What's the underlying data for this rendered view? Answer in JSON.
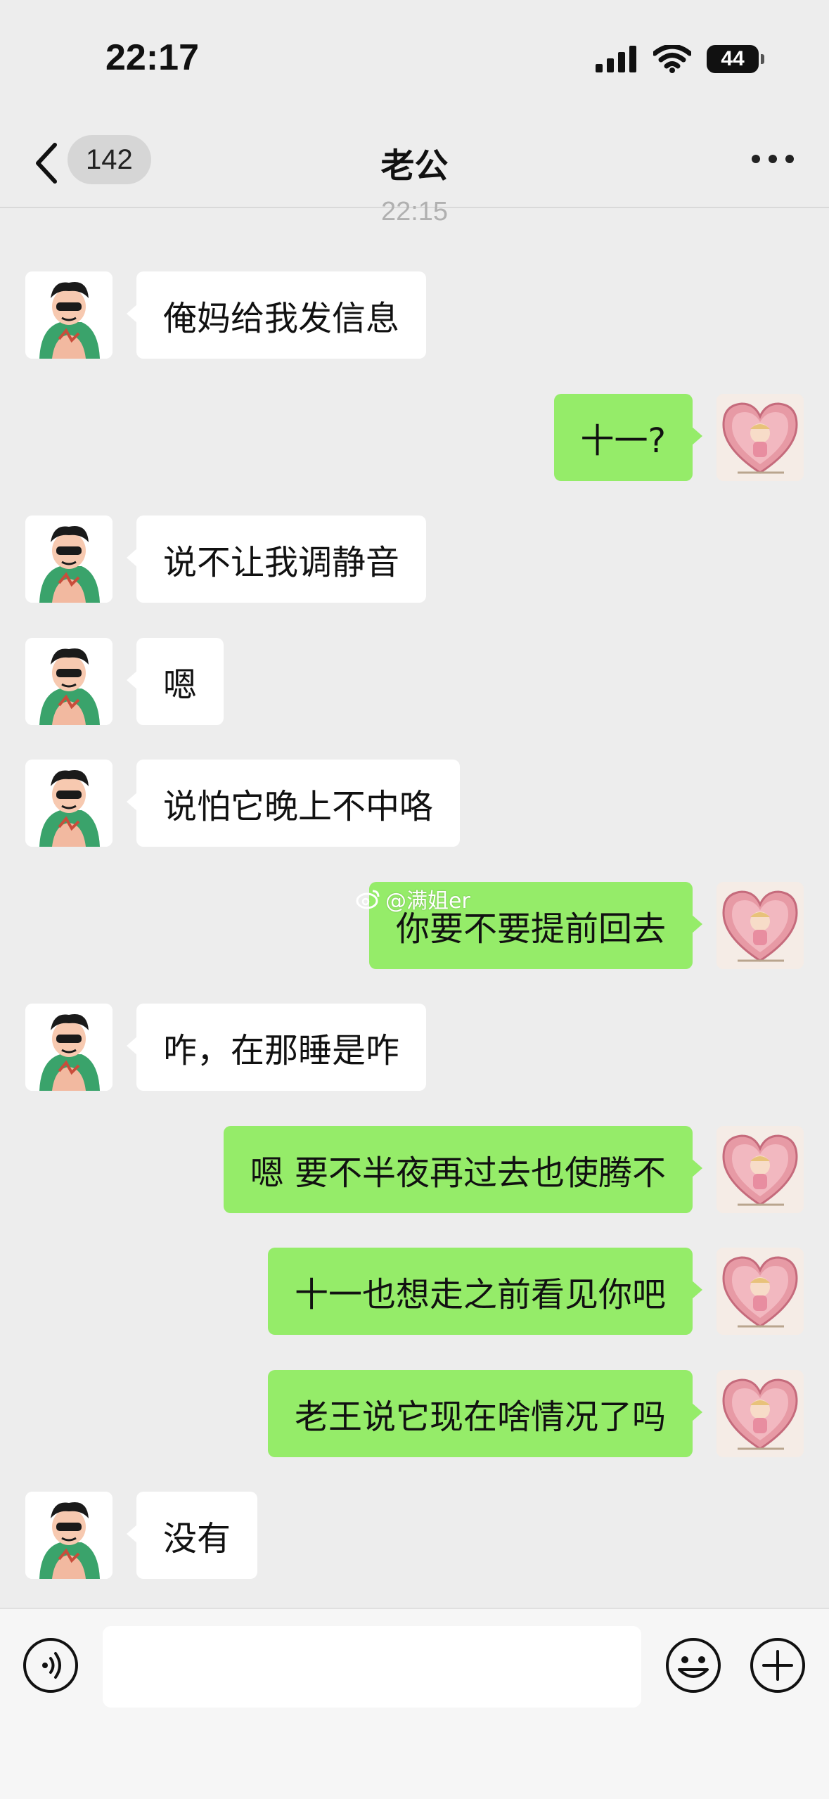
{
  "status_bar": {
    "time": "22:17",
    "battery": "44"
  },
  "nav": {
    "unread_count": "142",
    "title": "老公"
  },
  "timestamp": "22:15",
  "messages": [
    {
      "side": "in",
      "text": "俺妈给我发信息"
    },
    {
      "side": "out",
      "text": "十一?"
    },
    {
      "side": "in",
      "text": "说不让我调静音"
    },
    {
      "side": "in",
      "text": "嗯"
    },
    {
      "side": "in",
      "text": "说怕它晚上不中咯"
    },
    {
      "side": "out",
      "text": "你要不要提前回去"
    },
    {
      "side": "in",
      "text": "咋，在那睡是咋"
    },
    {
      "side": "out",
      "text": "嗯 要不半夜再过去也使腾不"
    },
    {
      "side": "out",
      "text": "十一也想走之前看见你吧"
    },
    {
      "side": "out",
      "text": "老王说它现在啥情况了吗"
    },
    {
      "side": "in",
      "text": "没有"
    }
  ],
  "watermark": "@满姐er",
  "input": {
    "value": ""
  },
  "colors": {
    "background": "#ededed",
    "outgoing_bubble": "#95ec69",
    "incoming_bubble": "#ffffff"
  }
}
